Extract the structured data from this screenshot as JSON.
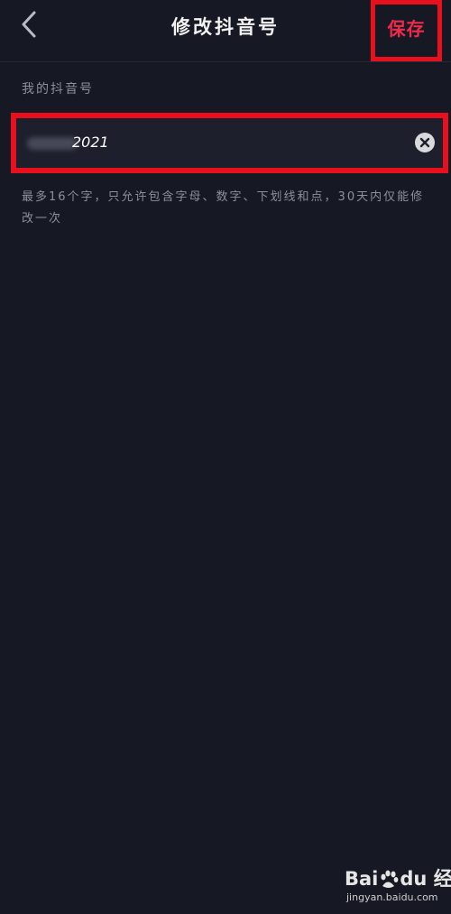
{
  "header": {
    "title": "修改抖音号",
    "save_label": "保存",
    "back_icon": "chevron-left-icon"
  },
  "form": {
    "label": "我的抖音号",
    "input_value": "2021",
    "clear_icon": "clear-circle-icon",
    "hint": "最多16个字，只允许包含字母、数字、下划线和点，30天内仅能修改一次"
  },
  "watermark": {
    "brand_part1": "Bai",
    "brand_part2": "du",
    "brand_suffix": "经验",
    "url": "jingyan.baidu.com"
  },
  "colors": {
    "background": "#161824",
    "accent": "#f02a4a",
    "highlight_box": "#e8101c"
  }
}
